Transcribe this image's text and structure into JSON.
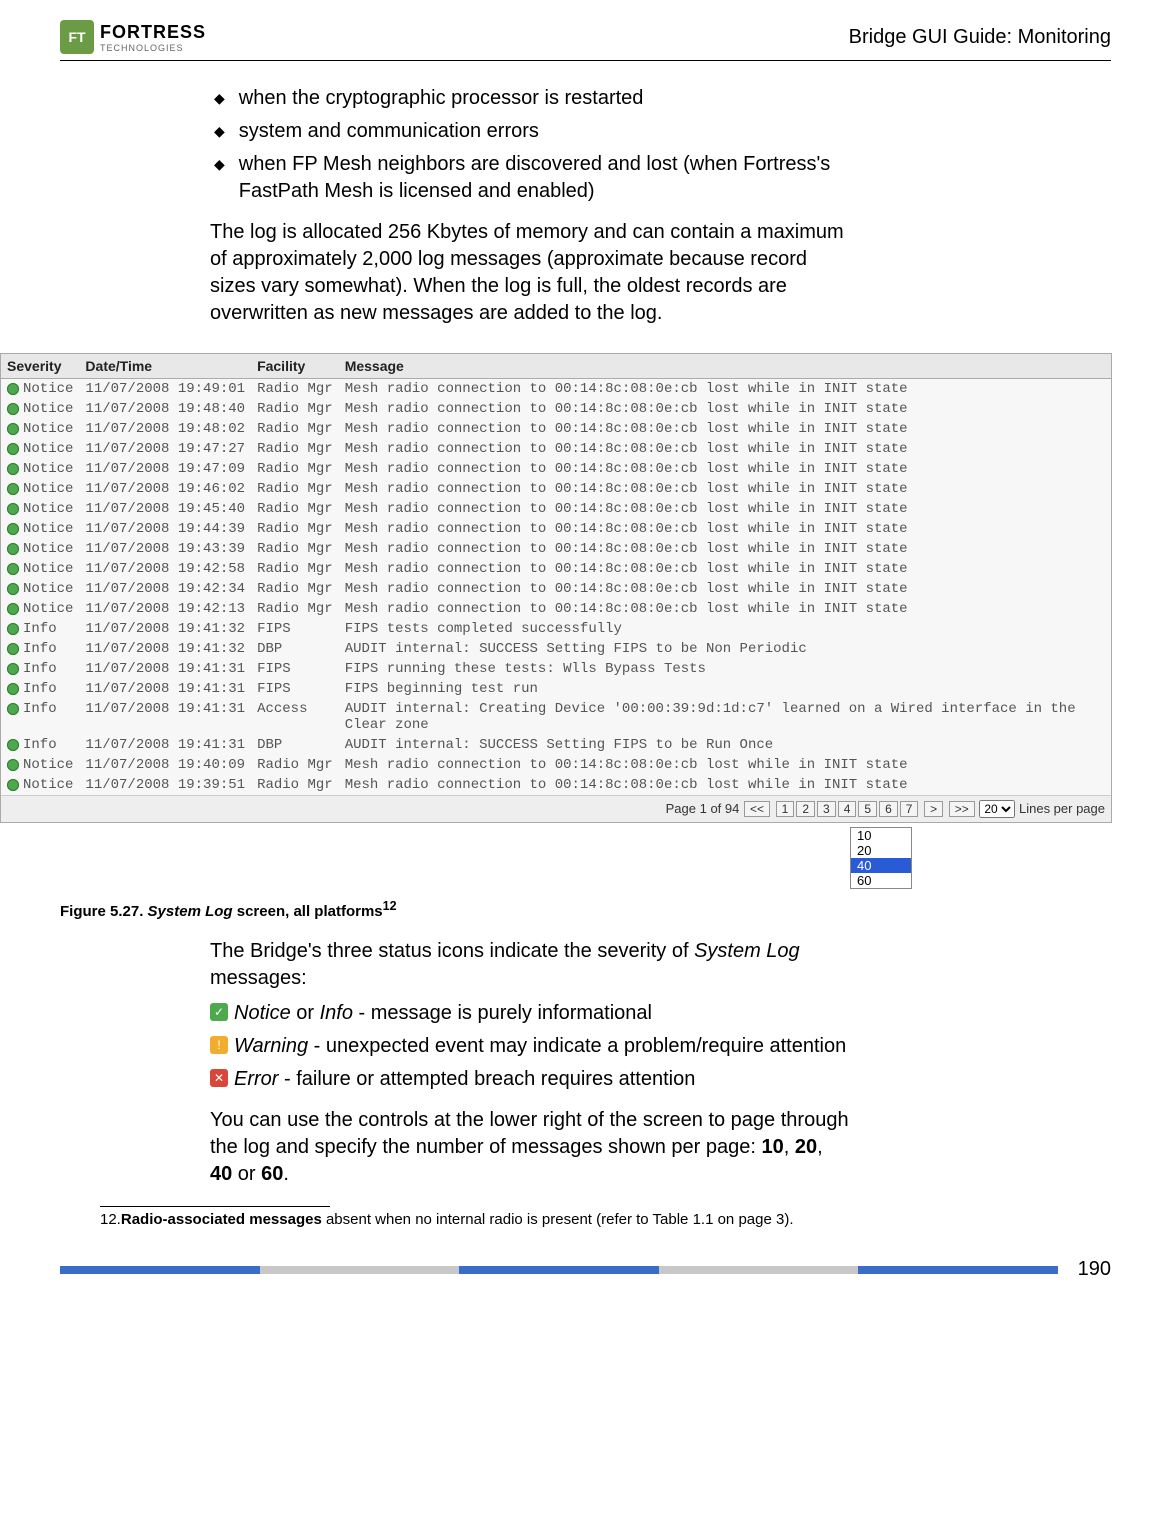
{
  "header": {
    "logo_main": "FORTRESS",
    "logo_sub": "TECHNOLOGIES",
    "title": "Bridge GUI Guide: Monitoring"
  },
  "bullets": [
    "when the cryptographic processor is restarted",
    "system and communication errors",
    "when FP Mesh neighbors are discovered and lost (when Fortress's FastPath Mesh is licensed and enabled)"
  ],
  "para1": "The log is allocated 256 Kbytes of memory and can contain a maximum of approximately 2,000 log messages (approximate because record sizes vary somewhat). When the log is full, the oldest records are overwritten as new messages are added to the log.",
  "log": {
    "headers": {
      "sev": "Severity",
      "dt": "Date/Time",
      "fac": "Facility",
      "msg": "Message"
    },
    "rows": [
      {
        "sev": "Notice",
        "dt": "11/07/2008 19:49:01",
        "fac": "Radio Mgr",
        "msg": "Mesh radio connection to 00:14:8c:08:0e:cb lost while in INIT state"
      },
      {
        "sev": "Notice",
        "dt": "11/07/2008 19:48:40",
        "fac": "Radio Mgr",
        "msg": "Mesh radio connection to 00:14:8c:08:0e:cb lost while in INIT state"
      },
      {
        "sev": "Notice",
        "dt": "11/07/2008 19:48:02",
        "fac": "Radio Mgr",
        "msg": "Mesh radio connection to 00:14:8c:08:0e:cb lost while in INIT state"
      },
      {
        "sev": "Notice",
        "dt": "11/07/2008 19:47:27",
        "fac": "Radio Mgr",
        "msg": "Mesh radio connection to 00:14:8c:08:0e:cb lost while in INIT state"
      },
      {
        "sev": "Notice",
        "dt": "11/07/2008 19:47:09",
        "fac": "Radio Mgr",
        "msg": "Mesh radio connection to 00:14:8c:08:0e:cb lost while in INIT state"
      },
      {
        "sev": "Notice",
        "dt": "11/07/2008 19:46:02",
        "fac": "Radio Mgr",
        "msg": "Mesh radio connection to 00:14:8c:08:0e:cb lost while in INIT state"
      },
      {
        "sev": "Notice",
        "dt": "11/07/2008 19:45:40",
        "fac": "Radio Mgr",
        "msg": "Mesh radio connection to 00:14:8c:08:0e:cb lost while in INIT state"
      },
      {
        "sev": "Notice",
        "dt": "11/07/2008 19:44:39",
        "fac": "Radio Mgr",
        "msg": "Mesh radio connection to 00:14:8c:08:0e:cb lost while in INIT state"
      },
      {
        "sev": "Notice",
        "dt": "11/07/2008 19:43:39",
        "fac": "Radio Mgr",
        "msg": "Mesh radio connection to 00:14:8c:08:0e:cb lost while in INIT state"
      },
      {
        "sev": "Notice",
        "dt": "11/07/2008 19:42:58",
        "fac": "Radio Mgr",
        "msg": "Mesh radio connection to 00:14:8c:08:0e:cb lost while in INIT state"
      },
      {
        "sev": "Notice",
        "dt": "11/07/2008 19:42:34",
        "fac": "Radio Mgr",
        "msg": "Mesh radio connection to 00:14:8c:08:0e:cb lost while in INIT state"
      },
      {
        "sev": "Notice",
        "dt": "11/07/2008 19:42:13",
        "fac": "Radio Mgr",
        "msg": "Mesh radio connection to 00:14:8c:08:0e:cb lost while in INIT state"
      },
      {
        "sev": "Info",
        "dt": "11/07/2008 19:41:32",
        "fac": "FIPS",
        "msg": "FIPS tests completed successfully"
      },
      {
        "sev": "Info",
        "dt": "11/07/2008 19:41:32",
        "fac": "DBP",
        "msg": "AUDIT internal: SUCCESS Setting FIPS to be Non Periodic"
      },
      {
        "sev": "Info",
        "dt": "11/07/2008 19:41:31",
        "fac": "FIPS",
        "msg": "FIPS running these tests: Wlls Bypass Tests"
      },
      {
        "sev": "Info",
        "dt": "11/07/2008 19:41:31",
        "fac": "FIPS",
        "msg": "FIPS beginning test run"
      },
      {
        "sev": "Info",
        "dt": "11/07/2008 19:41:31",
        "fac": "Access",
        "msg": "AUDIT internal: Creating Device '00:00:39:9d:1d:c7' learned on a Wired interface in the Clear zone"
      },
      {
        "sev": "Info",
        "dt": "11/07/2008 19:41:31",
        "fac": "DBP",
        "msg": "AUDIT internal: SUCCESS Setting FIPS to be Run Once"
      },
      {
        "sev": "Notice",
        "dt": "11/07/2008 19:40:09",
        "fac": "Radio Mgr",
        "msg": "Mesh radio connection to 00:14:8c:08:0e:cb lost while in INIT state"
      },
      {
        "sev": "Notice",
        "dt": "11/07/2008 19:39:51",
        "fac": "Radio Mgr",
        "msg": "Mesh radio connection to 00:14:8c:08:0e:cb lost while in INIT state"
      }
    ],
    "pager": {
      "info": "Page 1 of 94",
      "first": "<<",
      "pages": [
        "1",
        "2",
        "3",
        "4",
        "5",
        "6",
        "7"
      ],
      "next": ">",
      "last": ">>",
      "select": "20",
      "suffix": "Lines per page",
      "dropdown": [
        "10",
        "20",
        "40",
        "60"
      ]
    }
  },
  "caption": {
    "prefix": "Figure 5.27. ",
    "emph": "System Log",
    "suffix": " screen, all platforms",
    "sup": "12"
  },
  "para2_a": "The Bridge's three status icons indicate the severity of ",
  "para2_b": "System Log",
  "para2_c": " messages:",
  "legend": [
    {
      "cls": "ic-notice",
      "label_i": "Notice",
      "mid": " or ",
      "label_i2": "Info",
      "rest": " - message is purely informational"
    },
    {
      "cls": "ic-warn",
      "label_i": "Warning",
      "mid": "",
      "label_i2": "",
      "rest": " - unexpected event may indicate a problem/require attention"
    },
    {
      "cls": "ic-error",
      "label_i": "Error",
      "mid": "",
      "label_i2": "",
      "rest": " - failure or attempted breach requires attention"
    }
  ],
  "para3_a": "You can use the controls at the lower right of the screen to page through the log and specify the number of messages shown per page: ",
  "para3_bold1": "10",
  "para3_sep": ", ",
  "para3_bold2": "20",
  "para3_bold3": "40",
  "para3_or": " or ",
  "para3_bold4": "60",
  "para3_dot": ".",
  "footnote": {
    "num": "12.",
    "bold": "Radio-associated messages",
    "rest": " absent when no internal radio is present (refer to Table 1.1 on page 3)."
  },
  "page_num": "190"
}
